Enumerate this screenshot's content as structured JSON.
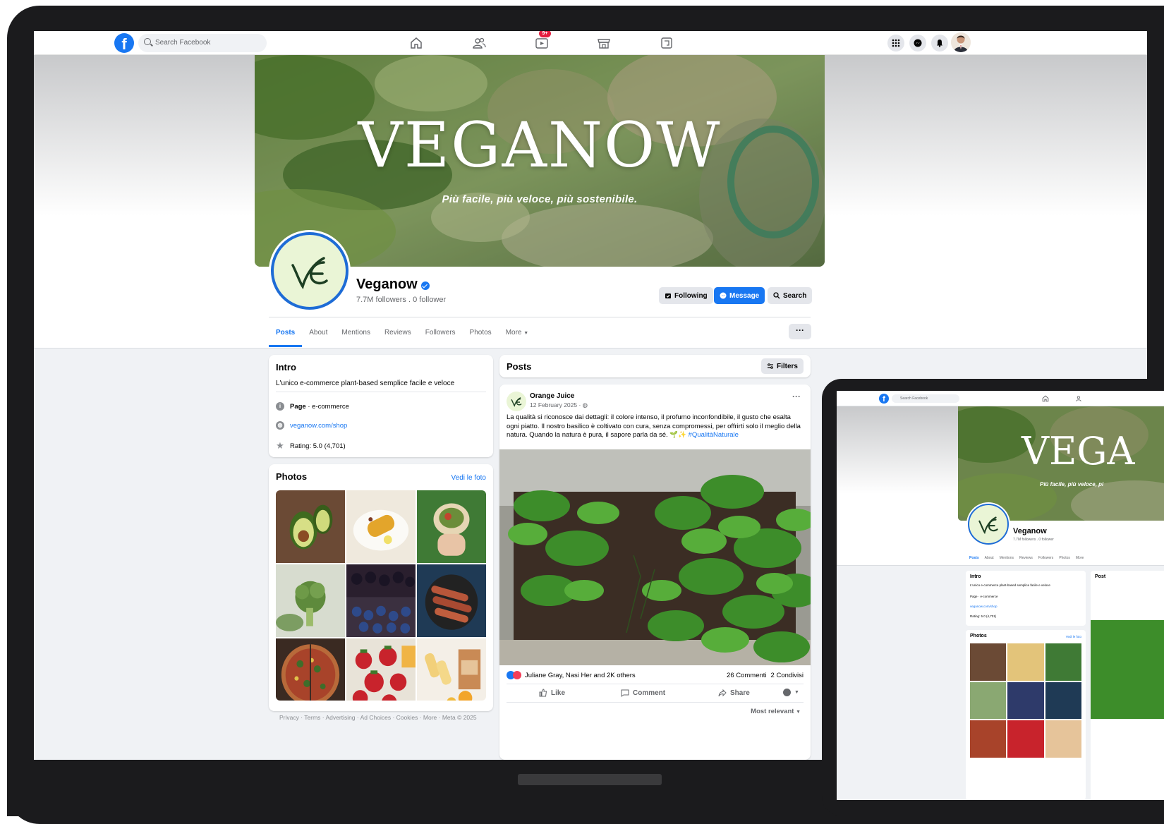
{
  "topnav": {
    "logo": "f",
    "search_placeholder": "Search Facebook",
    "video_badge": "9+",
    "icons": [
      "home-icon",
      "friends-icon",
      "video-icon",
      "marketplace-icon",
      "gaming-icon",
      "menu-grid-icon",
      "messenger-icon",
      "notifications-icon"
    ]
  },
  "cover": {
    "title": "VEGANOW",
    "tagline": "Più facile, più veloce, più sostenibile."
  },
  "profile": {
    "name": "Veganow",
    "followers": "7.7M followers . 0 follower",
    "logo_letter": "VE"
  },
  "actions": {
    "following": "Following",
    "message": "Message",
    "search": "Search"
  },
  "tabs": [
    "Posts",
    "About",
    "Mentions",
    "Reviews",
    "Followers",
    "Photos",
    "More"
  ],
  "more_menu": "···",
  "intro": {
    "title": "Intro",
    "description": "L'unico e-commerce plant-based semplice facile e veloce",
    "page_label": "Page",
    "page_type": " · e-commerce",
    "website": "veganow.com/shop",
    "rating": "Rating: 5.0 (4,701)"
  },
  "photos": {
    "title": "Photos",
    "see_all": "Vedi le foto",
    "items": [
      "avocado",
      "grilled-corn",
      "wrap",
      "broccoli",
      "berries",
      "sausages",
      "pizza",
      "strawberries",
      "popsicles"
    ]
  },
  "footer": "Privacy · Terms · Advertising · Ad Choices · Cookies · More · Meta © 2025",
  "posts_header": {
    "title": "Posts",
    "filters": "Filters"
  },
  "post": {
    "author": "Orange Juice",
    "date": "12 February 2025 · ",
    "text": "La qualità si riconosce dai dettagli: il colore intenso, il profumo inconfondibile, il gusto che esalta ogni piatto. Il nostro basilico è coltivato con cura, senza compromessi, per offrirti solo il meglio della natura. Quando la natura è pura, il sapore parla da sé. ",
    "hashtag": "#QualitàNaturale",
    "reactions_text": "Juliane Gray, Nasi Her and 2K others",
    "comments": "26 Commenti",
    "shares": "2 Condivisi",
    "like": "Like",
    "comment": "Comment",
    "share": "Share",
    "sort": "Most relevant"
  },
  "tablet": {
    "search_placeholder": "Search Facebook",
    "cover_title": "VEGA",
    "cover_tagline": "Più facile, più veloce, pi",
    "name": "Veganow",
    "followers": "7.7M followers . 0 follower",
    "tabs": [
      "Posts",
      "About",
      "Mentions",
      "Reviews",
      "Followers",
      "Photos",
      "More"
    ],
    "intro_title": "Intro",
    "intro_desc": "L'unico e-commerce plant-based semplice facile e veloce",
    "intro_page": "Page · e-commerce",
    "intro_site": "veganow.com/shop",
    "intro_rating": "Rating: 5.0 (4,701)",
    "photos_title": "Photos",
    "photos_see": "Vedi le foto",
    "posts_title": "Post"
  },
  "colors": {
    "brand_blue": "#1877f2",
    "page_bg": "#f0f2f5",
    "frame": "#1b1b1d",
    "badge_red": "#e41e3f"
  }
}
